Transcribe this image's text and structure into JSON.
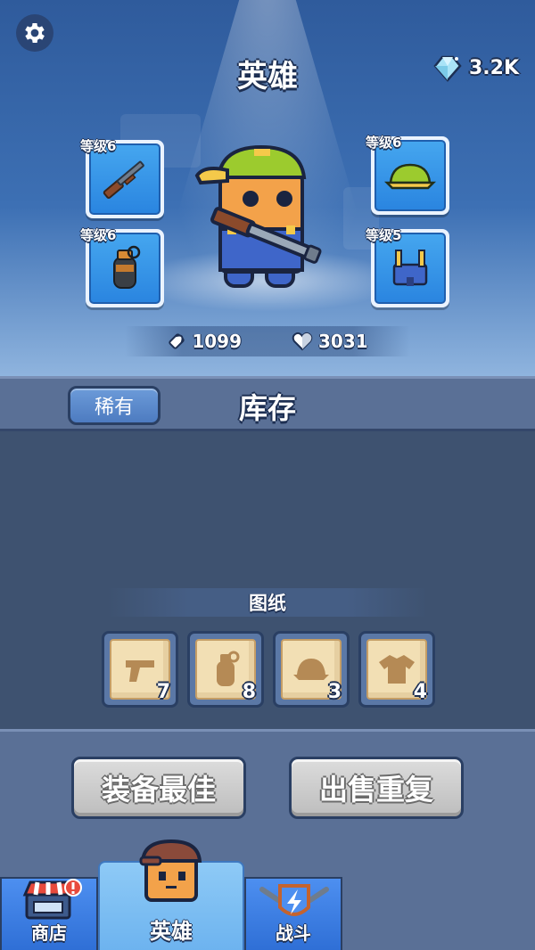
{
  "header": {
    "title": "英雄",
    "gems": "3.2K"
  },
  "equipment": {
    "left": [
      {
        "level": "等级6",
        "icon": "rifle-icon"
      },
      {
        "level": "等级6",
        "icon": "grenade-icon"
      }
    ],
    "right": [
      {
        "level": "等级6",
        "icon": "cap-icon"
      },
      {
        "level": "等级5",
        "icon": "overalls-icon"
      }
    ]
  },
  "stats": {
    "attack": "1099",
    "health": "3031"
  },
  "inventory": {
    "filter_label": "稀有",
    "title": "库存",
    "blueprints_label": "图纸",
    "blueprints": [
      {
        "icon": "pistol-icon",
        "count": "7"
      },
      {
        "icon": "grenade-icon",
        "count": "8"
      },
      {
        "icon": "cap-icon",
        "count": "3"
      },
      {
        "icon": "shirt-icon",
        "count": "4"
      }
    ]
  },
  "actions": {
    "equip_best": "装备最佳",
    "sell_duplicates": "出售重复"
  },
  "tabs": [
    {
      "label": "商店",
      "icon": "shop-icon"
    },
    {
      "label": "英雄",
      "icon": "hero-icon"
    },
    {
      "label": "战斗",
      "icon": "battle-icon"
    }
  ],
  "colors": {
    "slot_blue": "#2a85e0",
    "panel": "#5a7096",
    "inventory_bg": "#3e5270",
    "blueprint_paper": "#f2dfb4",
    "hero_cap": "#9ccb2e"
  }
}
